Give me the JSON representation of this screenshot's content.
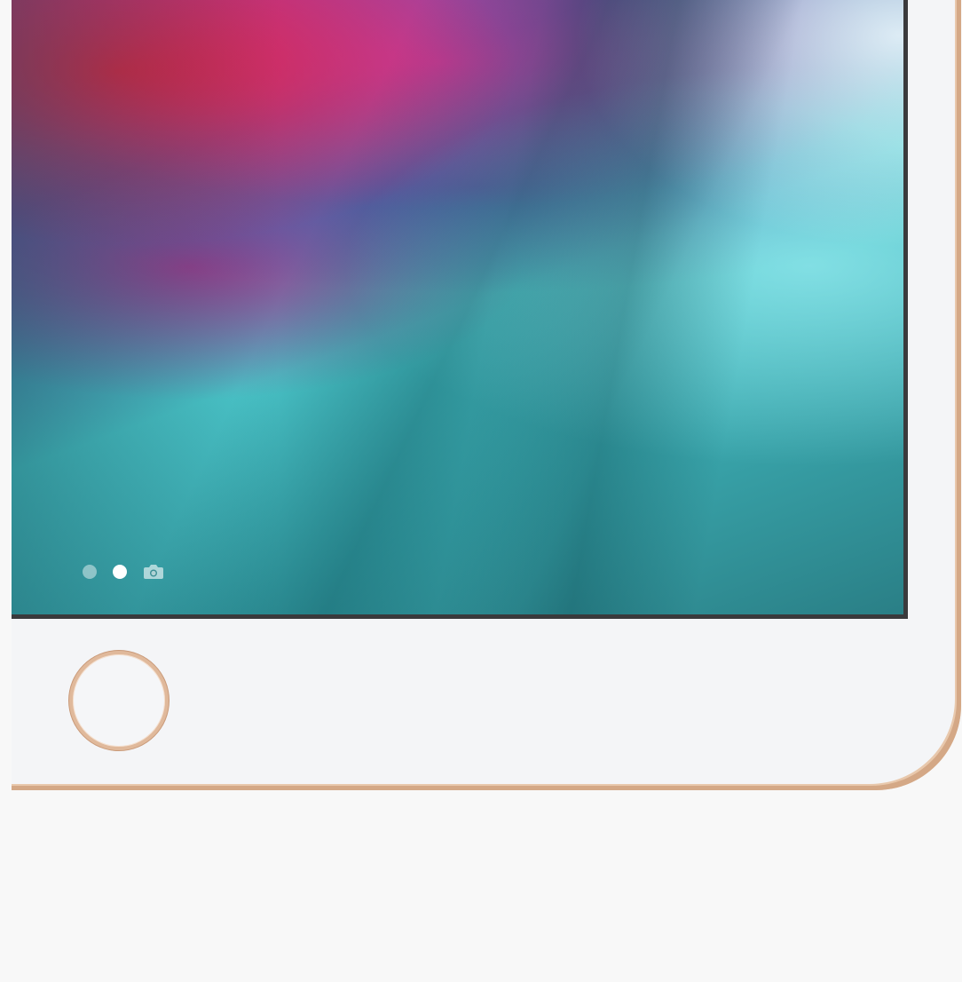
{
  "device": {
    "frame_color": "#f4f5f7",
    "accent_color": "#d4a886",
    "screen_border_color": "#3a3a3c"
  },
  "home_screen": {
    "pages": [
      {
        "icon": "page-dot-icon",
        "active": false
      },
      {
        "icon": "page-dot-icon",
        "active": true
      },
      {
        "icon": "camera-icon",
        "active": false
      }
    ]
  },
  "home_button": {
    "icon": "home-button-ring",
    "ring_color": "#e0b99b"
  }
}
